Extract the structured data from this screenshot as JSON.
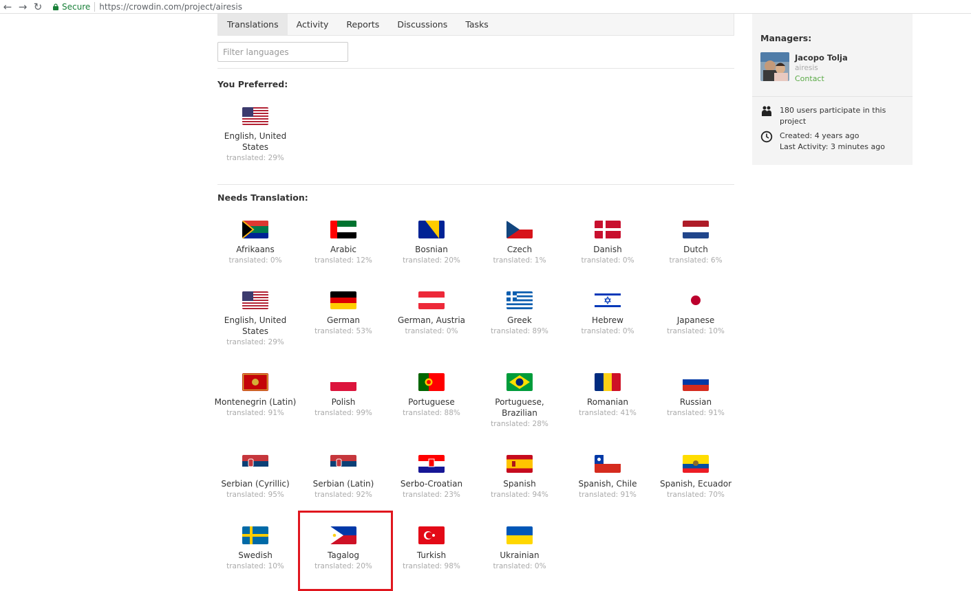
{
  "browser": {
    "secure_label": "Secure",
    "url": "https://crowdin.com/project/airesis"
  },
  "tabs": [
    {
      "label": "Translations"
    },
    {
      "label": "Activity"
    },
    {
      "label": "Reports"
    },
    {
      "label": "Discussions"
    },
    {
      "label": "Tasks"
    }
  ],
  "filter": {
    "placeholder": "Filter languages"
  },
  "preferred": {
    "title": "You Preferred:",
    "items": [
      {
        "name": "English, United States",
        "translated": "translated: 29%",
        "flag": "us-flag"
      }
    ]
  },
  "needs": {
    "title": "Needs Translation:",
    "items": [
      {
        "name": "Afrikaans",
        "translated": "translated: 0%",
        "flag": "za-flag"
      },
      {
        "name": "Arabic",
        "translated": "translated: 12%",
        "flag": "ae-flag"
      },
      {
        "name": "Bosnian",
        "translated": "translated: 20%",
        "flag": "ba-flag"
      },
      {
        "name": "Czech",
        "translated": "translated: 1%",
        "flag": "cz-flag"
      },
      {
        "name": "Danish",
        "translated": "translated: 0%",
        "flag": "dk-flag"
      },
      {
        "name": "Dutch",
        "translated": "translated: 6%",
        "flag": "nl-flag"
      },
      {
        "name": "English, United States",
        "translated": "translated: 29%",
        "flag": "us-flag"
      },
      {
        "name": "German",
        "translated": "translated: 53%",
        "flag": "de-flag"
      },
      {
        "name": "German, Austria",
        "translated": "translated: 0%",
        "flag": "at-flag"
      },
      {
        "name": "Greek",
        "translated": "translated: 89%",
        "flag": "gr-flag"
      },
      {
        "name": "Hebrew",
        "translated": "translated: 0%",
        "flag": "il-flag"
      },
      {
        "name": "Japanese",
        "translated": "translated: 10%",
        "flag": "jp-flag"
      },
      {
        "name": "Montenegrin (Latin)",
        "translated": "translated: 91%",
        "flag": "me-flag"
      },
      {
        "name": "Polish",
        "translated": "translated: 99%",
        "flag": "pl-flag"
      },
      {
        "name": "Portuguese",
        "translated": "translated: 88%",
        "flag": "pt-flag"
      },
      {
        "name": "Portuguese, Brazilian",
        "translated": "translated: 28%",
        "flag": "br-flag"
      },
      {
        "name": "Romanian",
        "translated": "translated: 41%",
        "flag": "ro-flag"
      },
      {
        "name": "Russian",
        "translated": "translated: 91%",
        "flag": "ru-flag"
      },
      {
        "name": "Serbian (Cyrillic)",
        "translated": "translated: 95%",
        "flag": "rs-flag"
      },
      {
        "name": "Serbian (Latin)",
        "translated": "translated: 92%",
        "flag": "rs-flag"
      },
      {
        "name": "Serbo-Croatian",
        "translated": "translated: 23%",
        "flag": "hr-flag"
      },
      {
        "name": "Spanish",
        "translated": "translated: 94%",
        "flag": "es-flag"
      },
      {
        "name": "Spanish, Chile",
        "translated": "translated: 91%",
        "flag": "cl-flag"
      },
      {
        "name": "Spanish, Ecuador",
        "translated": "translated: 70%",
        "flag": "ec-flag"
      },
      {
        "name": "Swedish",
        "translated": "translated: 10%",
        "flag": "se-flag"
      },
      {
        "name": "Tagalog",
        "translated": "translated: 20%",
        "flag": "ph-flag"
      },
      {
        "name": "Turkish",
        "translated": "translated: 98%",
        "flag": "tr-flag"
      },
      {
        "name": "Ukrainian",
        "translated": "translated: 0%",
        "flag": "ua-flag"
      }
    ]
  },
  "sidebar": {
    "managers_title": "Managers:",
    "manager": {
      "name": "Jacopo Tolja",
      "username": "airesis",
      "contact_label": "Contact"
    },
    "participants": "180 users participate in this project",
    "created": "Created: 4 years ago",
    "last_activity": "Last Activity: 3 minutes ago"
  },
  "colors": {
    "highlight": "#e0161e",
    "contact": "#5aaa46"
  }
}
